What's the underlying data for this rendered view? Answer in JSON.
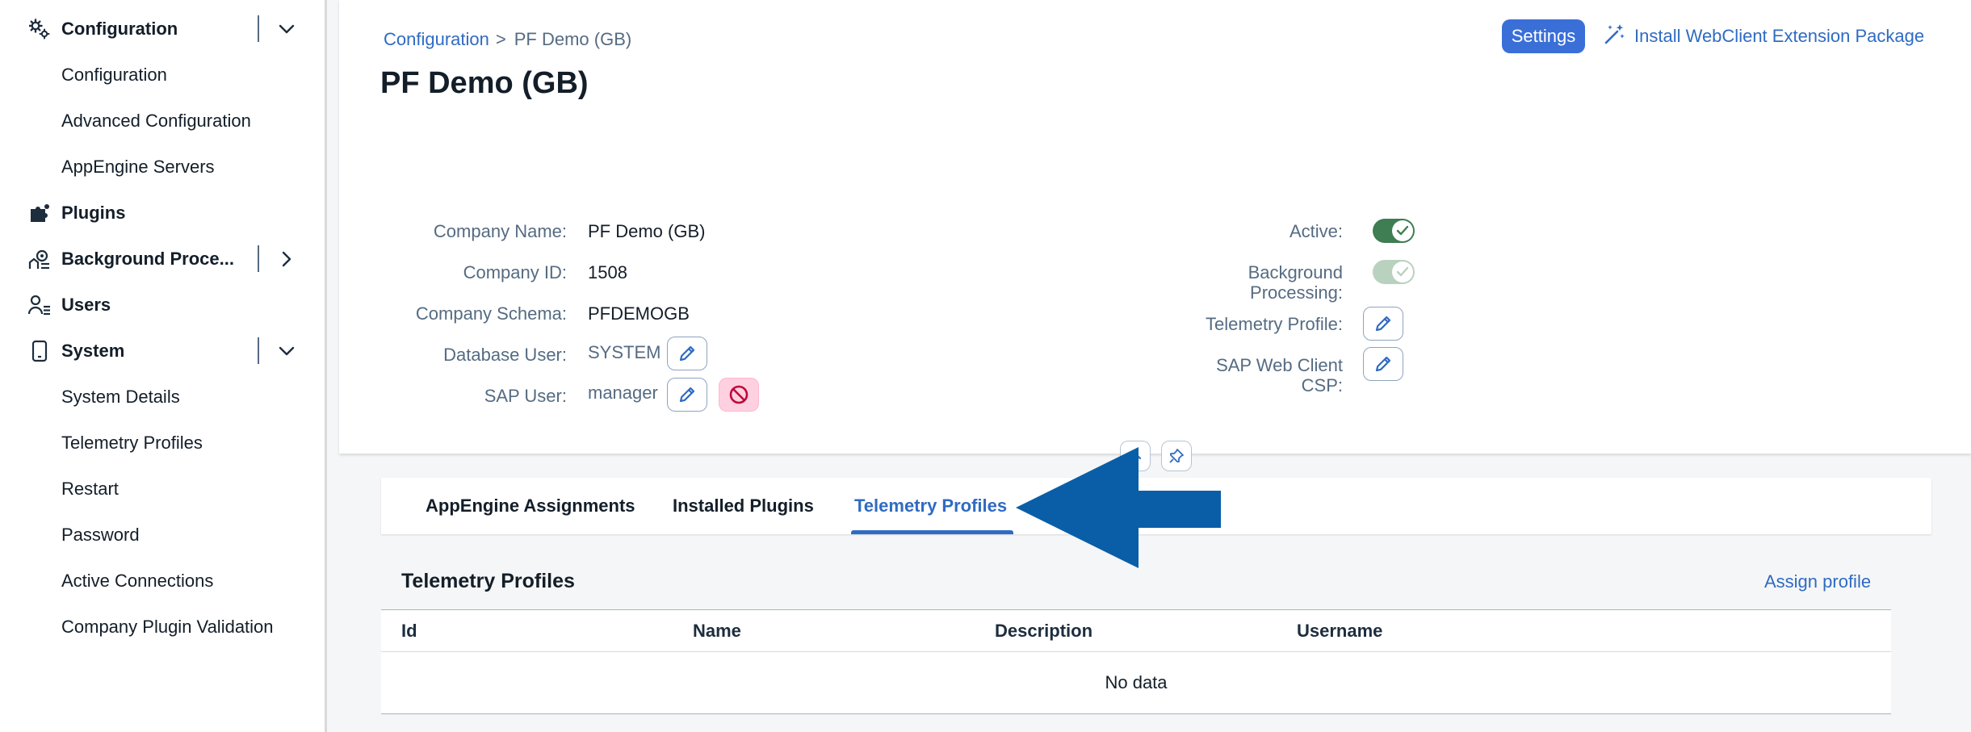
{
  "sidebar": {
    "groups": [
      {
        "label": "Configuration",
        "expanded": true,
        "items": [
          "Configuration",
          "Advanced Configuration",
          "AppEngine Servers"
        ]
      },
      {
        "label": "Plugins"
      },
      {
        "label": "Background Proce...",
        "expanded": false
      },
      {
        "label": "Users"
      },
      {
        "label": "System",
        "expanded": true,
        "items": [
          "System Details",
          "Telemetry Profiles",
          "Restart",
          "Password",
          "Active Connections",
          "Company Plugin Validation"
        ]
      }
    ]
  },
  "breadcrumb": {
    "link": "Configuration",
    "separator": ">",
    "current": "PF Demo (GB)"
  },
  "page_title": "PF Demo (GB)",
  "actions": {
    "settings_label": "Settings",
    "install_label": "Install WebClient Extension Package"
  },
  "fields": {
    "company_name": {
      "label": "Company Name:",
      "value": "PF Demo (GB)"
    },
    "company_id": {
      "label": "Company ID:",
      "value": "1508"
    },
    "company_schema": {
      "label": "Company Schema:",
      "value": "PFDEMOGB"
    },
    "database_user": {
      "label": "Database User:",
      "value": "SYSTEM"
    },
    "sap_user": {
      "label": "SAP User:",
      "value": "manager"
    },
    "active": {
      "label": "Active:",
      "on": true
    },
    "background_processing": {
      "label_line1": "Background",
      "label_line2": "Processing:",
      "on": true,
      "disabled": true
    },
    "telemetry_profile": {
      "label": "Telemetry Profile:"
    },
    "sap_web_client_csp": {
      "label_line1": "SAP Web Client",
      "label_line2": "CSP:"
    }
  },
  "tabs": [
    {
      "label": "AppEngine Assignments",
      "selected": false
    },
    {
      "label": "Installed Plugins",
      "selected": false
    },
    {
      "label": "Telemetry Profiles",
      "selected": true
    }
  ],
  "section": {
    "title": "Telemetry Profiles",
    "assign_label": "Assign profile",
    "columns": [
      "Id",
      "Name",
      "Description",
      "Username"
    ],
    "empty_text": "No data"
  },
  "colors": {
    "accent": "#2f6bc2",
    "switch_on": "#3f7d52",
    "switch_disabled": "#b9d2bf",
    "annotation_arrow": "#0a5ea8"
  }
}
